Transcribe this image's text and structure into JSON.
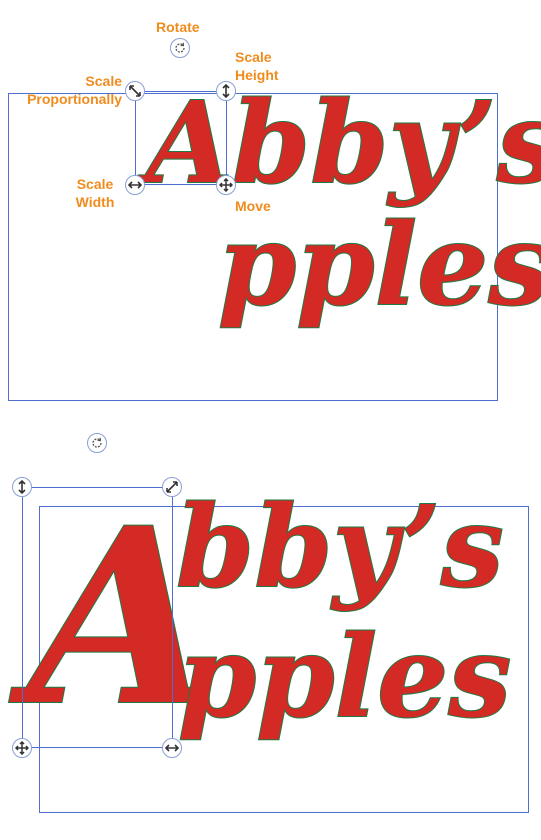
{
  "callouts": {
    "rotate": "Rotate",
    "scale_height": "Scale\nHeight",
    "scale_proportionally": "Scale\nProportionally",
    "scale_width": "Scale\nWidth",
    "move": "Move"
  },
  "top_example": {
    "letter_a": "A",
    "line1_rest": "bby’s",
    "line2_rest": "pples"
  },
  "bottom_example": {
    "letter_a": "A",
    "line1_rest": "bby’s",
    "line2_rest": "pples"
  },
  "colors": {
    "letter_fill": "#d32a25",
    "letter_outline": "#1e7a43",
    "selection": "#4f6fd0",
    "callout_text": "#f08c1e"
  },
  "icons": {
    "rotate": "rotate-icon",
    "scale_proportional": "diagonal-arrows-icon",
    "scale_height": "vertical-arrows-icon",
    "scale_width": "horizontal-arrows-icon",
    "move": "move-arrows-icon"
  }
}
